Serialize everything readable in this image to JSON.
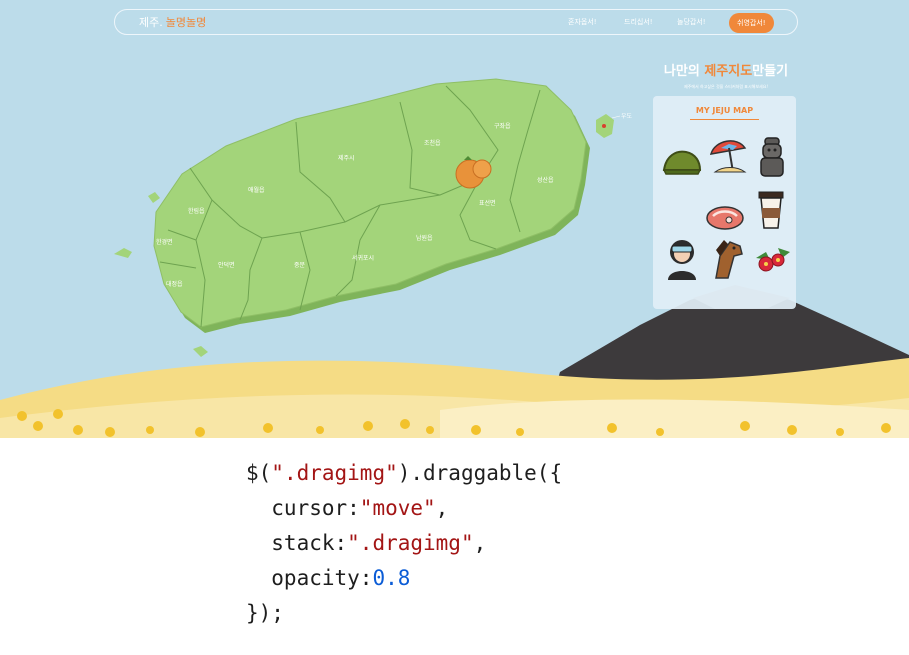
{
  "nav": {
    "logo_prefix": "제주.",
    "logo_accent": "놀명놀명",
    "items": [
      {
        "label": "혼자옵서!"
      },
      {
        "label": "드리십서!"
      },
      {
        "label": "놀당갑서!"
      },
      {
        "label": "쉬영갑서!"
      }
    ],
    "active_index": 3
  },
  "map": {
    "regions": [
      "구좌읍",
      "조천읍",
      "제주시",
      "애월읍",
      "한림읍",
      "한경면",
      "대정읍",
      "안덕면",
      "중문",
      "서귀포시",
      "남원읍",
      "표선면",
      "성산읍",
      "우도"
    ]
  },
  "panel": {
    "title_prefix": "나만의 ",
    "title_accent": "제주지도",
    "title_suffix": "만들기",
    "subtitle": "제주에서 하고싶은 것을 스티커처럼 표시해보세요!",
    "heading": "MY JEJU MAP",
    "stickers": [
      "grass-hill-icon",
      "beach-umbrella-icon",
      "dol-hareubang-icon",
      "black-pork-icon",
      "coffee-cup-icon",
      "haenyeo-diver-icon",
      "jeju-horse-icon",
      "camellia-icon"
    ]
  },
  "code": {
    "line1_a": "$(",
    "line1_str": "\".dragimg\"",
    "line1_b": ").draggable({",
    "line2_a": "  cursor:",
    "line2_str": "\"move\"",
    "line2_b": ",",
    "line3_a": "  stack:",
    "line3_str": "\".dragimg\"",
    "line3_b": ",",
    "line4_a": "  opacity:",
    "line4_num": "0.8",
    "line5": "});"
  },
  "colors": {
    "accent": "#f0883a",
    "sky": "#bcdcea",
    "island": "#a3d47a",
    "string": "#a31515",
    "number": "#0b5cd6"
  }
}
